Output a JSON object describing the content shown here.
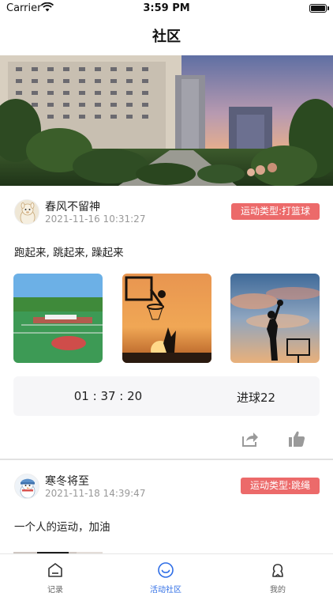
{
  "status_bar": {
    "carrier": "Carrier",
    "time": "3:59 PM"
  },
  "nav": {
    "title": "社区"
  },
  "posts": [
    {
      "username": "春风不留神",
      "time": "2021-11-16 10:31:27",
      "sport_type": "运动类型:打篮球",
      "text": "跑起来, 跳起来, 躁起来",
      "stats": {
        "duration": "01 : 37 : 20",
        "goals": "进球22"
      }
    },
    {
      "username": "寒冬将至",
      "time": "2021-11-18 14:39:47",
      "sport_type": "运动类型:跳绳",
      "text": "一个人的运动，加油"
    }
  ],
  "tab_bar": {
    "items": [
      {
        "label": "记录",
        "icon": "home-icon",
        "active": false
      },
      {
        "label": "活动社区",
        "icon": "smile-icon",
        "active": true
      },
      {
        "label": "我的",
        "icon": "user-icon",
        "active": false
      }
    ]
  },
  "colors": {
    "accent": "#2f6ee6",
    "badge": "#ec6a6a",
    "stats_bg": "#f6f6f8"
  }
}
